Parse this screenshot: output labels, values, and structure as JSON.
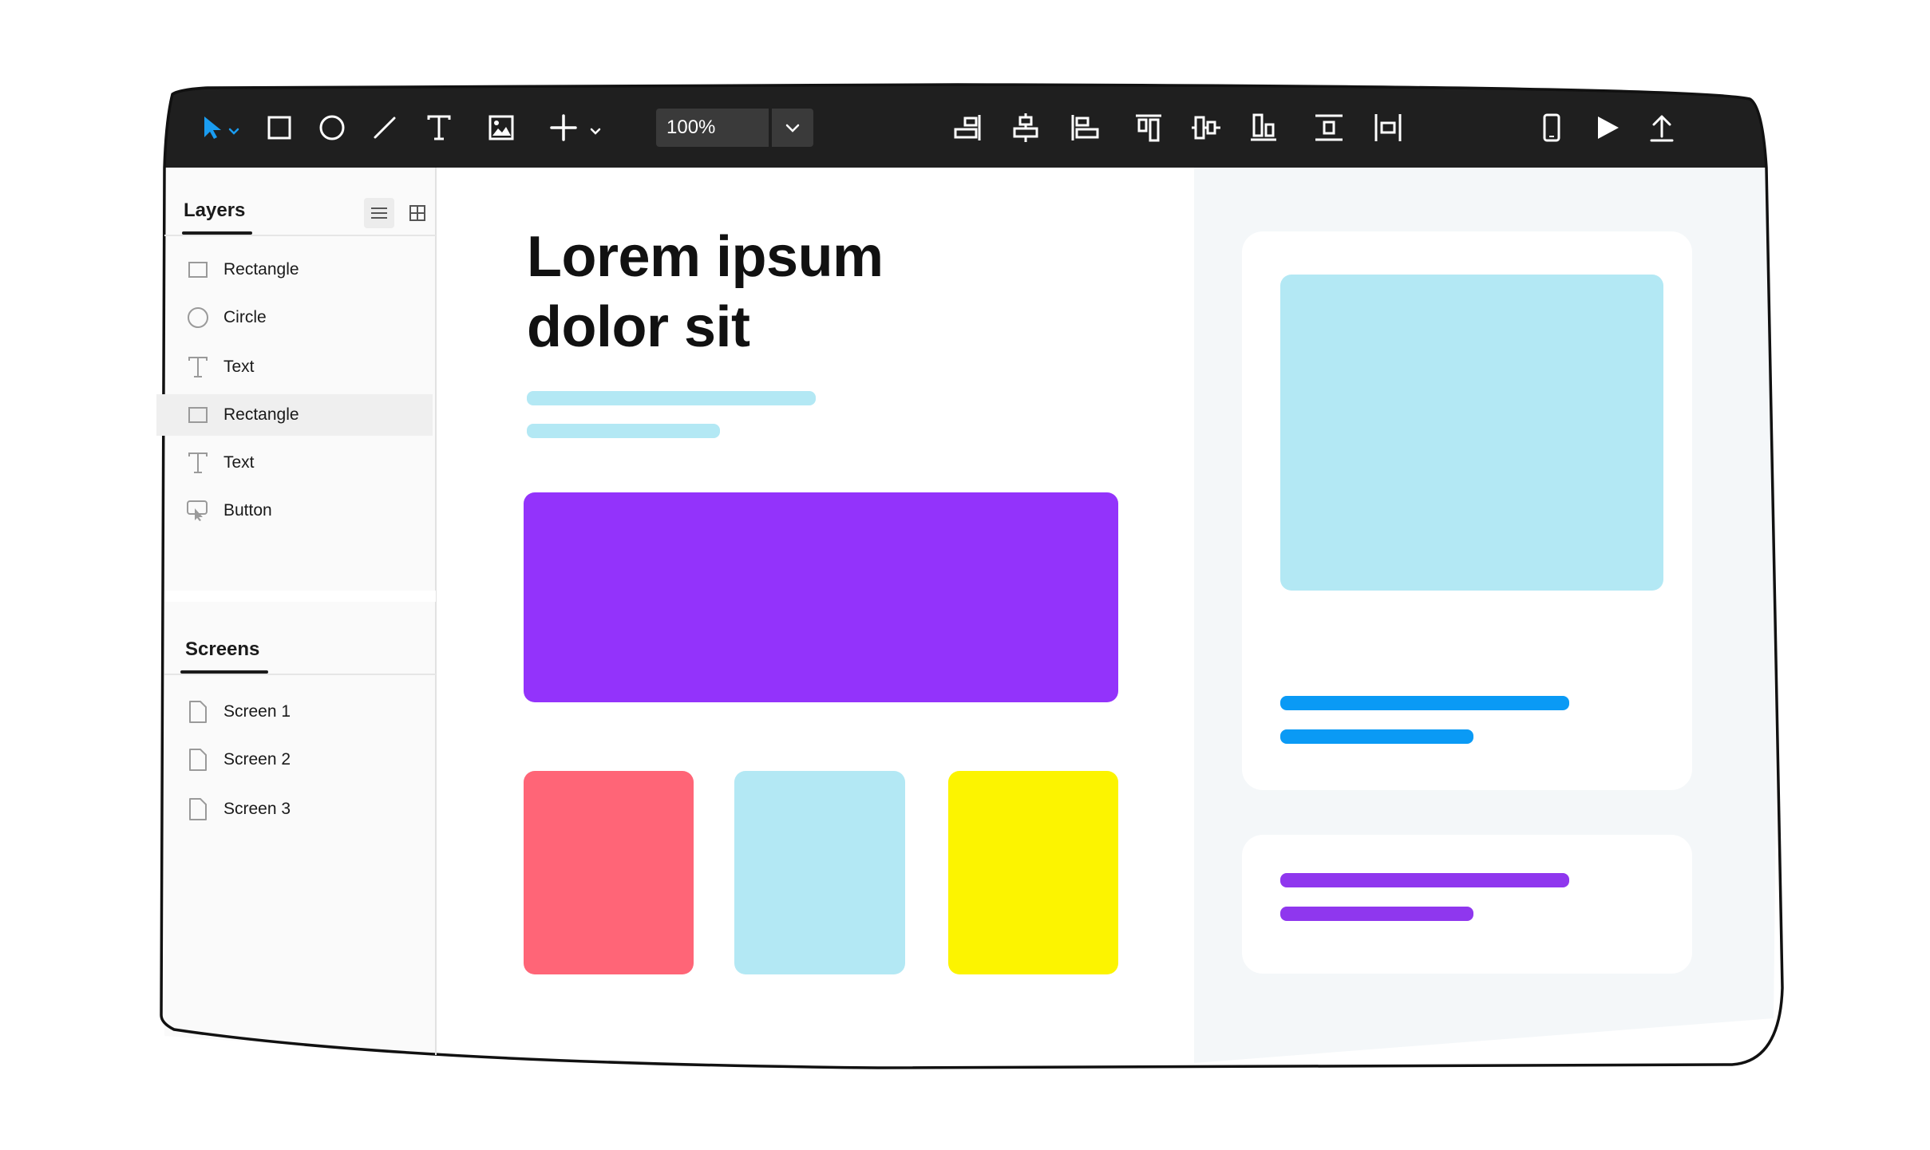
{
  "toolbar": {
    "tools": [
      {
        "name": "select-tool",
        "icon": "cursor-arrow-icon"
      },
      {
        "name": "rectangle-tool",
        "icon": "square-icon"
      },
      {
        "name": "ellipse-tool",
        "icon": "circle-icon"
      },
      {
        "name": "line-tool",
        "icon": "line-icon"
      },
      {
        "name": "text-tool",
        "icon": "text-t-icon"
      },
      {
        "name": "image-tool",
        "icon": "image-icon"
      },
      {
        "name": "add-tool",
        "icon": "plus-icon"
      }
    ],
    "zoom_value": "100%",
    "align_icons": [
      "align-right-icon",
      "align-center-horizontal-icon",
      "align-left-icon",
      "align-top-icon",
      "align-middle-vertical-icon",
      "align-bottom-icon",
      "distribute-vertical-icon",
      "distribute-horizontal-icon"
    ],
    "right_icons": [
      "mobile-preview-icon",
      "play-icon",
      "upload-icon"
    ],
    "accent_color": "#1a9cf0",
    "bg_color": "#1f1f1f"
  },
  "layers_panel": {
    "title": "Layers",
    "view_icons": [
      "list-view-icon",
      "grid-view-icon"
    ],
    "items": [
      {
        "label": "Rectangle",
        "icon": "rectangle-layer-icon"
      },
      {
        "label": "Circle",
        "icon": "circle-layer-icon"
      },
      {
        "label": "Text",
        "icon": "text-layer-icon"
      },
      {
        "label": "Rectangle",
        "icon": "rectangle-layer-icon",
        "selected": true
      },
      {
        "label": "Text",
        "icon": "text-layer-icon"
      },
      {
        "label": "Button",
        "icon": "button-layer-icon"
      }
    ]
  },
  "screens_panel": {
    "title": "Screens",
    "items": [
      {
        "label": "Screen 1",
        "icon": "page-icon"
      },
      {
        "label": "Screen 2",
        "icon": "page-icon"
      },
      {
        "label": "Screen 3",
        "icon": "page-icon"
      }
    ]
  },
  "canvas": {
    "headline_line1": "Lorem ipsum",
    "headline_line2": "dolor sit",
    "colors": {
      "light_blue": "#b3e8f4",
      "purple": "#9333fb",
      "coral": "#ff6577",
      "yellow": "#fcf400",
      "bright_blue": "#0a9af5",
      "violet": "#8f37ee",
      "panel_bg": "#f4f7f9"
    }
  }
}
